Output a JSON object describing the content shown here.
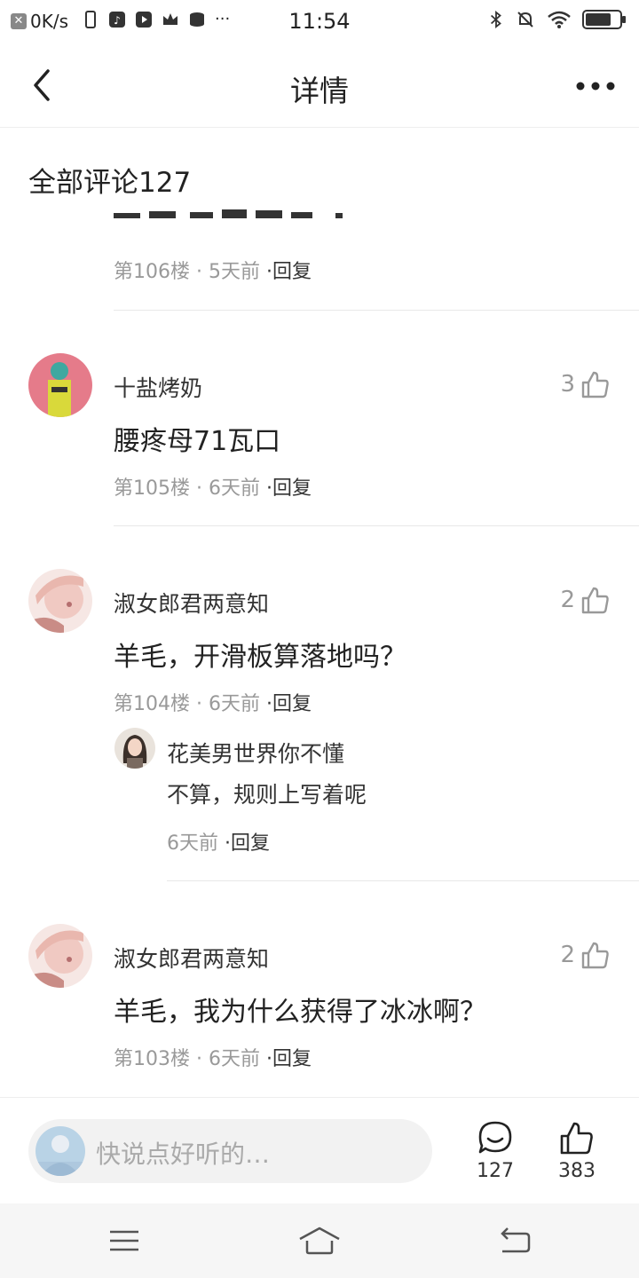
{
  "status_bar": {
    "net_speed": "0K/s",
    "time": "11:54"
  },
  "nav": {
    "title": "详情"
  },
  "section": {
    "title": "全部评论127"
  },
  "comments": [
    {
      "floor": "第106楼",
      "time": "5天前",
      "reply_label": "·回复"
    },
    {
      "user": "十盐烤奶",
      "text": "腰疼母71瓦口",
      "likes": "3",
      "floor": "第105楼",
      "time": "6天前",
      "reply_label": "·回复"
    },
    {
      "user": "淑女郎君两意知",
      "text": "羊毛，开滑板算落地吗？",
      "likes": "2",
      "floor": "第104楼",
      "time": "6天前",
      "reply_label": "·回复",
      "reply": {
        "user": "花美男世界你不懂",
        "text": "不算，规则上写着呢",
        "time": "6天前",
        "reply_label": "·回复"
      }
    },
    {
      "user": "淑女郎君两意知",
      "text": "羊毛，我为什么获得了冰冰啊？",
      "likes": "2",
      "floor": "第103楼",
      "time": "6天前",
      "reply_label": "·回复"
    }
  ],
  "bottom_bar": {
    "placeholder": "快说点好听的…",
    "comment_count": "127",
    "like_count": "383"
  },
  "meta_sep": " · "
}
